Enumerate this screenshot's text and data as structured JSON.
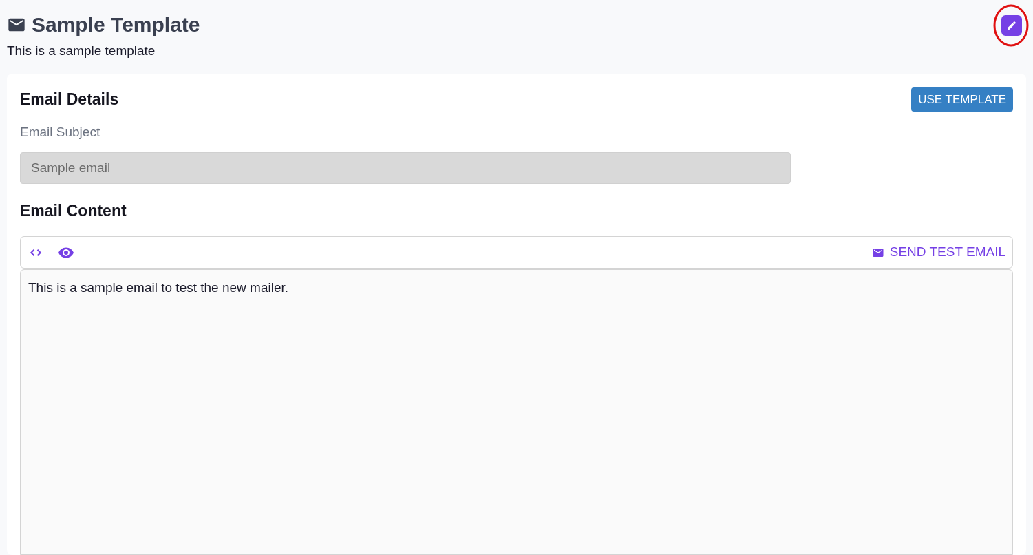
{
  "header": {
    "title": "Sample Template",
    "description": "This is a sample template",
    "edit_button": {
      "highlighted": true
    }
  },
  "email_details": {
    "heading": "Email Details",
    "use_button": "USE TEMPLATE",
    "subject_label": "Email Subject",
    "subject_value": "Sample email",
    "subject_disabled": true
  },
  "email_content": {
    "heading": "Email Content",
    "toolbar": [
      {
        "kind": "code",
        "selected": false
      },
      {
        "kind": "preview",
        "selected": false
      }
    ],
    "send_test": "SEND TEST EMAIL",
    "body": "This is a sample email to test the new mailer."
  }
}
